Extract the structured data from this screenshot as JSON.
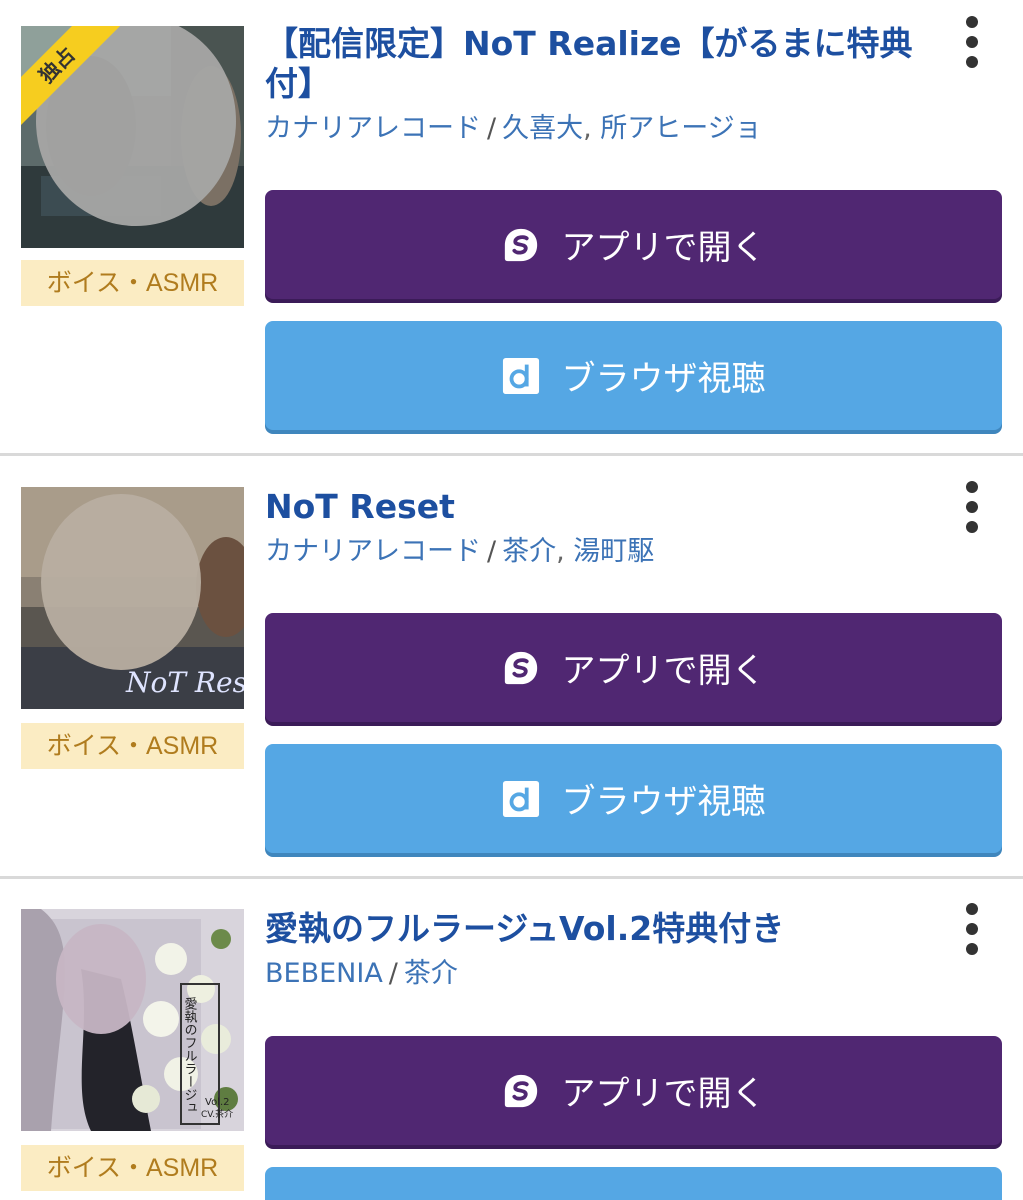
{
  "items": [
    {
      "badge": "独占",
      "title": "【配信限定】NoT Realize【がるまに特典付】",
      "label": "カナリアレコード",
      "cast": [
        "久喜大",
        "所アヒージョ"
      ],
      "genre": "ボイス・ASMR",
      "app_button": "アプリで開く",
      "browser_button": "ブラウザ視聴"
    },
    {
      "title": "NoT Reset",
      "label": "カナリアレコード",
      "cast": [
        "茶介",
        "湯町駆"
      ],
      "genre": "ボイス・ASMR",
      "cover_text": "NoT Reset",
      "app_button": "アプリで開く",
      "browser_button": "ブラウザ視聴"
    },
    {
      "title": "愛執のフルラージュVol.2特典付き",
      "label": "BEBENIA",
      "cast": [
        "茶介"
      ],
      "genre": "ボイス・ASMR",
      "cover_text": "愛執のフルラージュ",
      "cover_subtext": "Vol.2",
      "cover_cv": "CV.茶介",
      "app_button": "アプリで開く"
    }
  ],
  "separator": "/",
  "comma": ",",
  "colors": {
    "title": "#1d4fa0",
    "link": "#3c73b6",
    "app_button": "#502772",
    "browser_button": "#55a7e4",
    "genre_bg": "#fbecc3",
    "genre_text": "#b07c1e",
    "badge": "#f6cd1f"
  },
  "icons": {
    "app": "app-logo-icon",
    "browser": "d-logo-icon",
    "menu": "more-vertical-icon"
  }
}
